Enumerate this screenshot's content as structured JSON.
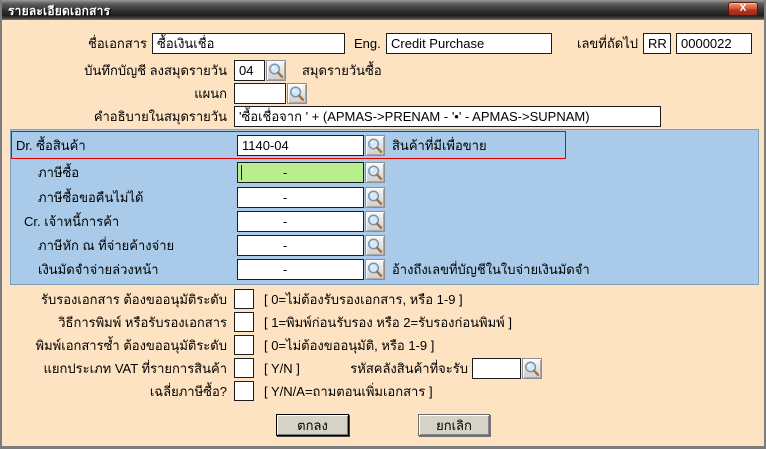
{
  "window": {
    "title": "รายละเอียดเอกสาร",
    "close_label": "X"
  },
  "colors": {
    "body_bg": "#fde3c1",
    "panel_bg": "#a9cbe9",
    "green_input_bg": "#b9ee8e",
    "highlight_border": "#e40000",
    "titlebar_bg": "#323232",
    "close_button_bg": "#b03520",
    "button_face": "#d6d2c6"
  },
  "header_row": {
    "doc_name_label": "ชื่อเอกสาร",
    "doc_name_value": "ซื้อเงินเชื่อ",
    "eng_label": "Eng.",
    "eng_value": "Credit Purchase",
    "next_no_label": "เลขที่ถัดไป",
    "next_no_prefix": "RR",
    "next_no_value": "0000022"
  },
  "journal_row": {
    "label": "บันทึกบัญชี ลงสมุดรายวัน",
    "value": "04",
    "note": "สมุดรายวันซื้อ"
  },
  "department_row": {
    "label": "แผนก",
    "value": ""
  },
  "description_row": {
    "label": "คำอธิบายในสมุดรายวัน",
    "value": "'ซื้อเชื่อจาก ' + (APMAS->PRENAM - '•' - APMAS->SUPNAM)"
  },
  "account_panel": {
    "rows": [
      {
        "label": "Dr. ซื้อสินค้า",
        "value": "1140-04",
        "note": "สินค้าที่มีเพื่อขาย"
      },
      {
        "label": "ภาษีซื้อ",
        "value": "-"
      },
      {
        "label": "ภาษีซื้อขอคืนไม่ได้",
        "value": "-"
      },
      {
        "label": "Cr. เจ้าหนี้การค้า",
        "value": "-"
      },
      {
        "label": "ภาษีหัก ณ ที่จ่ายค้างจ่าย",
        "value": "-"
      },
      {
        "label": "เงินมัดจำจ่ายล่วงหน้า",
        "value": "-",
        "note": "อ้างถึงเลขที่บัญชีในใบจ่ายเงินมัดจำ"
      }
    ]
  },
  "options": {
    "approve_row": {
      "label": "รับรองเอกสาร ต้องขออนุมัติระดับ",
      "value": "",
      "hint": "[ 0=ไม่ต้องรับรองเอกสาร,  หรือ 1-9 ]"
    },
    "print_method_row": {
      "label": "วิธีการพิมพ์ หรือรับรองเอกสาร",
      "value": "",
      "hint": "[ 1=พิมพ์ก่อนรับรอง  หรือ 2=รับรองก่อนพิมพ์ ]"
    },
    "reprint_row": {
      "label": "พิมพ์เอกสารซ้ำ ต้องขออนุมัติระดับ",
      "value": "",
      "hint": "[ 0=ไม่ต้องขออนุมัติ,  หรือ 1-9 ]"
    },
    "vat_row": {
      "label": "แยกประเภท VAT ที่รายการสินค้า",
      "value": "",
      "hint": "[ Y/N ]",
      "warehouse_label": "รหัสคลังสินค้าที่จะรับ",
      "warehouse_value": ""
    },
    "avg_vat_row": {
      "label": "เฉลี่ยภาษีซื้อ?",
      "value": "",
      "hint": "[ Y/N/A=ถามตอนเพิ่มเอกสาร ]"
    }
  },
  "buttons": {
    "ok": "ตกลง",
    "cancel": "ยกเลิก"
  }
}
